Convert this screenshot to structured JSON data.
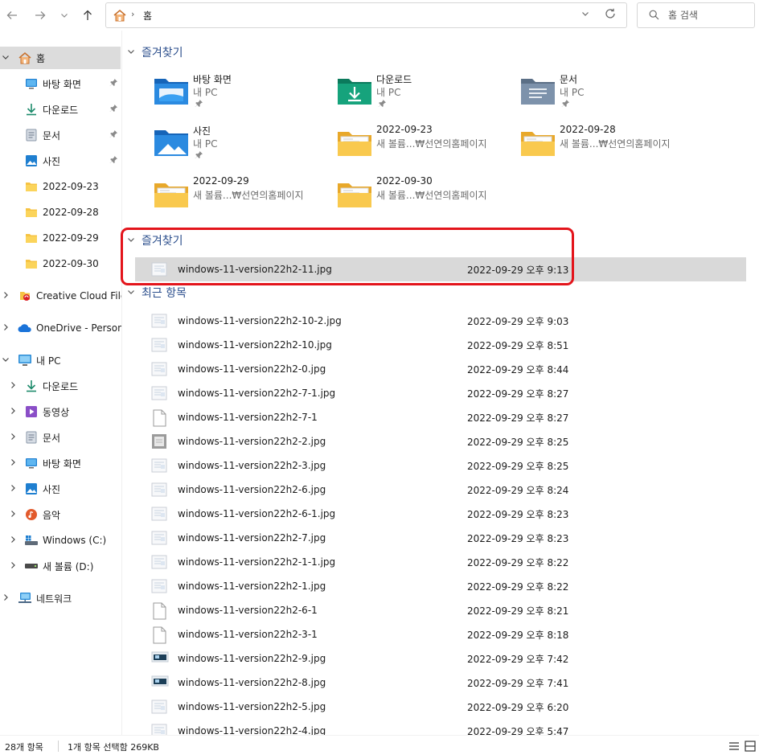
{
  "address": {
    "crumb": "홈"
  },
  "search": {
    "placeholder": "홈 검색"
  },
  "sidebar": {
    "home_label": "홈",
    "quick": [
      {
        "label": "바탕 화면",
        "icon": "desktop-icon",
        "pinned": true
      },
      {
        "label": "다운로드",
        "icon": "download-icon",
        "pinned": true
      },
      {
        "label": "문서",
        "icon": "document-icon",
        "pinned": true
      },
      {
        "label": "사진",
        "icon": "pictures-icon",
        "pinned": true
      },
      {
        "label": "2022-09-23",
        "icon": "folder-icon",
        "pinned": false
      },
      {
        "label": "2022-09-28",
        "icon": "folder-icon",
        "pinned": false
      },
      {
        "label": "2022-09-29",
        "icon": "folder-icon",
        "pinned": false
      },
      {
        "label": "2022-09-30",
        "icon": "folder-icon",
        "pinned": false
      }
    ],
    "creative_cloud": "Creative Cloud Files",
    "onedrive": "OneDrive - Personal",
    "this_pc": "내 PC",
    "pc_items": [
      {
        "label": "다운로드",
        "icon": "download-icon"
      },
      {
        "label": "동영상",
        "icon": "videos-icon"
      },
      {
        "label": "문서",
        "icon": "document-icon"
      },
      {
        "label": "바탕 화면",
        "icon": "desktop-icon"
      },
      {
        "label": "사진",
        "icon": "pictures-icon"
      },
      {
        "label": "음악",
        "icon": "music-icon"
      },
      {
        "label": "Windows (C:)",
        "icon": "windows-drive-icon"
      },
      {
        "label": "새 볼륨 (D:)",
        "icon": "drive-icon"
      }
    ],
    "network": "네트워크"
  },
  "quick_access": {
    "header": "즐겨찾기",
    "tiles": [
      {
        "name": "바탕 화면",
        "sub": "내 PC",
        "icon": "desktop-folder-icon",
        "pinned": true
      },
      {
        "name": "다운로드",
        "sub": "내 PC",
        "icon": "download-folder-icon",
        "pinned": true
      },
      {
        "name": "문서",
        "sub": "내 PC",
        "icon": "documents-folder-icon",
        "pinned": true
      },
      {
        "name": "사진",
        "sub": "내 PC",
        "icon": "pictures-folder-icon",
        "pinned": true
      },
      {
        "name": "2022-09-23",
        "sub": "새 볼륨...₩선연의홈페이지",
        "icon": "folder-icon",
        "pinned": false
      },
      {
        "name": "2022-09-28",
        "sub": "새 볼륨...₩선연의홈페이지",
        "icon": "folder-icon",
        "pinned": false
      },
      {
        "name": "2022-09-29",
        "sub": "새 볼륨...₩선연의홈페이지",
        "icon": "folder-icon",
        "pinned": false
      },
      {
        "name": "2022-09-30",
        "sub": "새 볼륨...₩선연의홈페이지",
        "icon": "folder-icon",
        "pinned": false
      }
    ]
  },
  "favorites": {
    "header": "즐겨찾기",
    "files": [
      {
        "name": "windows-11-version22h2-11.jpg",
        "date": "2022-09-29 오후 9:13"
      }
    ]
  },
  "recent": {
    "header": "최근 항목",
    "files": [
      {
        "name": "windows-11-version22h2-10-2.jpg",
        "date": "2022-09-29 오후 9:03",
        "kind": "image"
      },
      {
        "name": "windows-11-version22h2-10.jpg",
        "date": "2022-09-29 오후 8:51",
        "kind": "image"
      },
      {
        "name": "windows-11-version22h2-0.jpg",
        "date": "2022-09-29 오후 8:44",
        "kind": "image"
      },
      {
        "name": "windows-11-version22h2-7-1.jpg",
        "date": "2022-09-29 오후 8:27",
        "kind": "image"
      },
      {
        "name": "windows-11-version22h2-7-1",
        "date": "2022-09-29 오후 8:27",
        "kind": "blank"
      },
      {
        "name": "windows-11-version22h2-2.jpg",
        "date": "2022-09-29 오후 8:25",
        "kind": "image-gray"
      },
      {
        "name": "windows-11-version22h2-3.jpg",
        "date": "2022-09-29 오후 8:25",
        "kind": "image"
      },
      {
        "name": "windows-11-version22h2-6.jpg",
        "date": "2022-09-29 오후 8:24",
        "kind": "image"
      },
      {
        "name": "windows-11-version22h2-6-1.jpg",
        "date": "2022-09-29 오후 8:23",
        "kind": "image"
      },
      {
        "name": "windows-11-version22h2-7.jpg",
        "date": "2022-09-29 오후 8:23",
        "kind": "image"
      },
      {
        "name": "windows-11-version22h2-1-1.jpg",
        "date": "2022-09-29 오후 8:22",
        "kind": "image"
      },
      {
        "name": "windows-11-version22h2-1.jpg",
        "date": "2022-09-29 오후 8:22",
        "kind": "image"
      },
      {
        "name": "windows-11-version22h2-6-1",
        "date": "2022-09-29 오후 8:21",
        "kind": "blank"
      },
      {
        "name": "windows-11-version22h2-3-1",
        "date": "2022-09-29 오후 8:18",
        "kind": "blank"
      },
      {
        "name": "windows-11-version22h2-9.jpg",
        "date": "2022-09-29 오후 7:42",
        "kind": "image-dark"
      },
      {
        "name": "windows-11-version22h2-8.jpg",
        "date": "2022-09-29 오후 7:41",
        "kind": "image-dark"
      },
      {
        "name": "windows-11-version22h2-5.jpg",
        "date": "2022-09-29 오후 6:20",
        "kind": "image"
      },
      {
        "name": "windows-11-version22h2-4.jpg",
        "date": "2022-09-29 오후 5:47",
        "kind": "image"
      }
    ]
  },
  "status": {
    "count": "28개 항목",
    "selection": "1개 항목 선택함 269KB"
  },
  "colors": {
    "highlight": "#e3141b",
    "section_header": "#2b4e8c",
    "folder": "#f6c343",
    "selected_row": "#d9d9d9"
  }
}
